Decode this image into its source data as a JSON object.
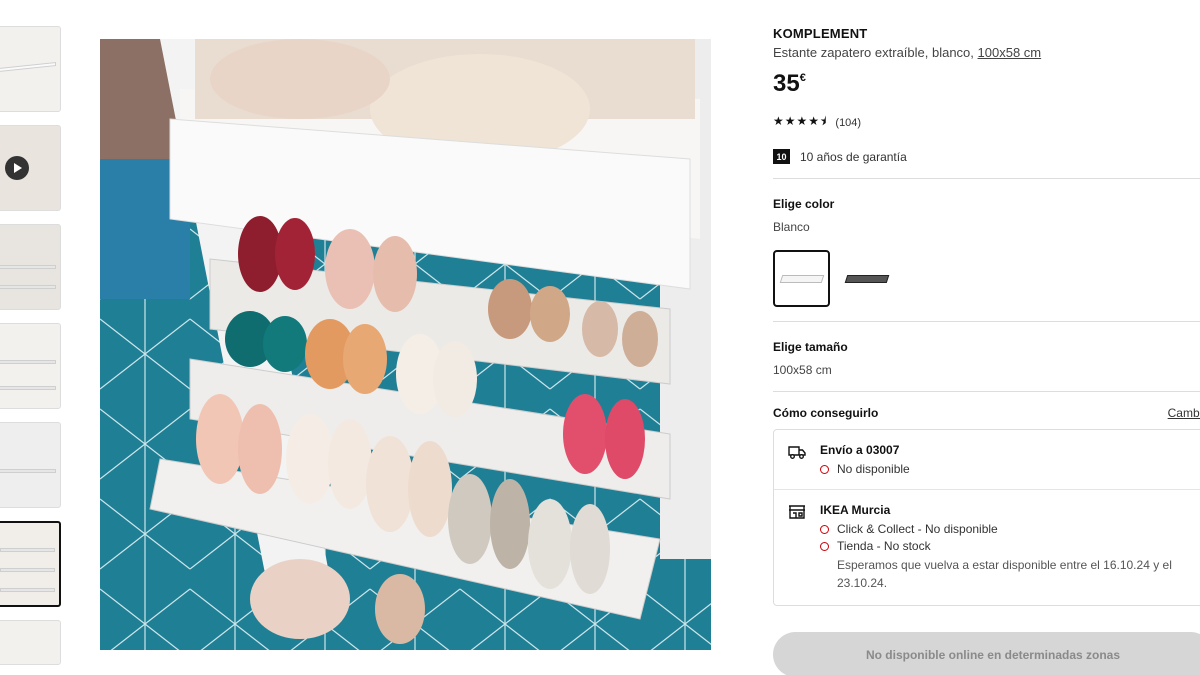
{
  "product": {
    "name": "KOMPLEMENT",
    "description": "Estante zapatero extraíble, blanco,",
    "size_link": "100x58 cm",
    "price_whole": "35",
    "price_currency": "€",
    "rating_stars": "★★★★⯨",
    "rating_value": 4.5,
    "review_count": "(104)",
    "warranty_badge": "10",
    "warranty_text": "10 años de garantía"
  },
  "color": {
    "label": "Elige color",
    "selected": "Blanco",
    "options": [
      "white-shelf",
      "dark-shelf"
    ]
  },
  "size": {
    "label": "Elige tamaño",
    "selected": "100x58 cm"
  },
  "availability": {
    "title": "Cómo conseguirlo",
    "change_link": "Cambiar",
    "delivery": {
      "icon": "truck-icon",
      "title": "Envío a 03007",
      "status": "No disponible"
    },
    "store": {
      "icon": "store-icon",
      "title": "IKEA Murcia",
      "click_collect": "Click & Collect - No disponible",
      "in_store": "Tienda - No stock",
      "restock_note": "Esperamos que vuelva a estar disponible entre el 16.10.24 y el 23.10.24."
    },
    "status_color": "#cc0008"
  },
  "cta": {
    "label": "No disponible online en determinadas zonas"
  },
  "gallery": {
    "thumbnail_count": 7,
    "active_index": 5
  }
}
